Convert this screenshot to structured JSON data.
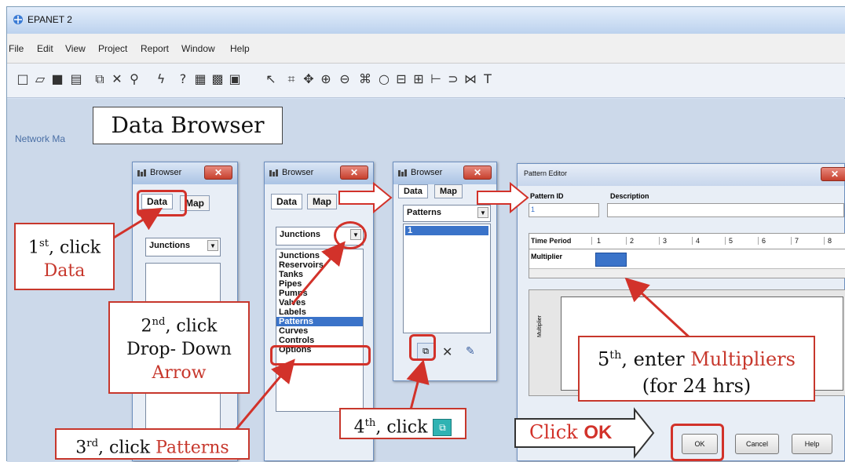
{
  "window": {
    "title": "EPANET 2"
  },
  "menu": [
    "File",
    "Edit",
    "View",
    "Project",
    "Report",
    "Window",
    "Help"
  ],
  "toolbar_icons": [
    "new-icon",
    "open-icon",
    "save-icon",
    "print-icon",
    "copy-icon",
    "delete-icon",
    "find-icon",
    "run-icon",
    "query-icon",
    "graph-icon",
    "table-icon",
    "options-icon",
    "select-icon",
    "vertex-icon",
    "pan-icon",
    "zoom-icon",
    "junction-icon",
    "reservoir-icon",
    "tank-icon",
    "pipe-icon",
    "pump-icon",
    "valve-icon",
    "label-icon"
  ],
  "network_map_label": "Network Ma",
  "data_browser_heading": "Data Browser",
  "browser1": {
    "title": "Browser",
    "tab_data": "Data",
    "tab_map": "Map",
    "dropdown": "Junctions"
  },
  "browser2": {
    "title": "Browser",
    "tab_data": "Data",
    "tab_map": "Map",
    "dropdown": "Junctions",
    "list": [
      "Junctions",
      "Reservoirs",
      "Tanks",
      "Pipes",
      "Pumps",
      "Valves",
      "Labels",
      "Patterns",
      "Curves",
      "Controls",
      "Options"
    ],
    "selected": "Patterns"
  },
  "browser3": {
    "title": "Browser",
    "tab_data": "Data",
    "tab_map": "Map",
    "dropdown": "Patterns",
    "list": [
      "1"
    ]
  },
  "pattern_editor": {
    "title": "Pattern Editor",
    "id_label": "Pattern ID",
    "desc_label": "Description",
    "id_value": "1",
    "time_label": "Time Period",
    "mult_label": "Multiplier",
    "periods": [
      "1",
      "2",
      "3",
      "4",
      "5",
      "6",
      "7",
      "8"
    ],
    "axis_label": "Multiplier",
    "buttons": {
      "ok": "OK",
      "cancel": "Cancel",
      "help": "Help"
    }
  },
  "callouts": {
    "step1_prefix": "1",
    "step1_sup": "st",
    "step1_text": ", click",
    "step1_red": "Data",
    "step2_prefix": "2",
    "step2_sup": "nd",
    "step2_text": ", click",
    "step2_line2": "Drop- Down",
    "step2_red": "Arrow",
    "step3_prefix": "3",
    "step3_sup": "rd",
    "step3_text": ", click ",
    "step3_red": "Patterns",
    "step4_prefix": "4",
    "step4_sup": "th",
    "step4_text": ", click",
    "step5_prefix": "5",
    "step5_sup": "th",
    "step5_text": ", enter ",
    "step5_red": "Multipliers",
    "step5_line2": "(for 24 hrs)",
    "click_ok_black": "Click ",
    "click_ok_red": "OK"
  },
  "colors": {
    "accent_red": "#c7372c",
    "selection_blue": "#3a73c9"
  }
}
